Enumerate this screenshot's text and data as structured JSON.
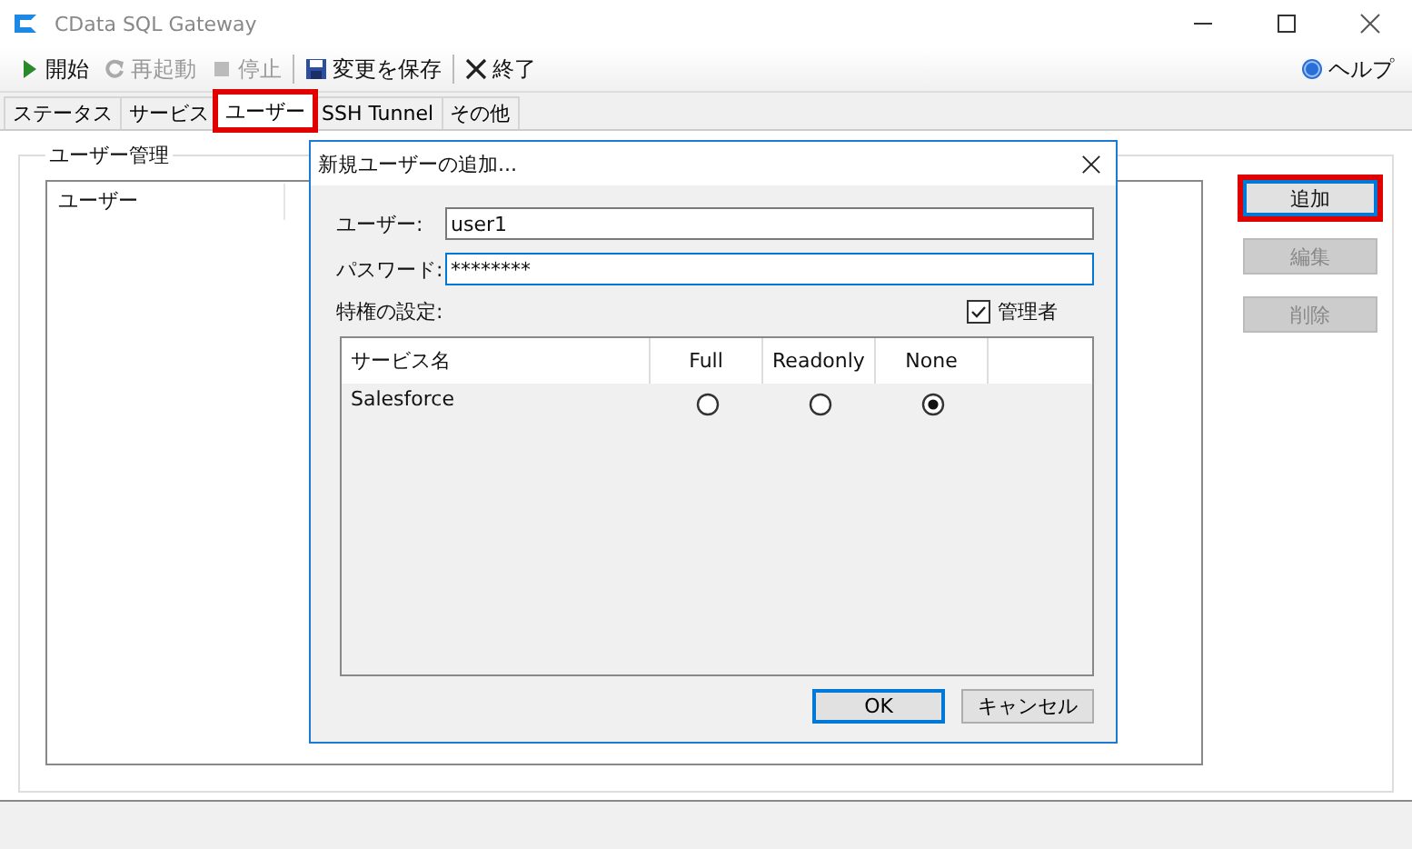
{
  "window": {
    "title": "CData SQL Gateway"
  },
  "toolbar": [
    {
      "label": "開始",
      "kind": "play",
      "disabled": false
    },
    {
      "label": "再起動",
      "kind": "restart",
      "disabled": true
    },
    {
      "label": "停止",
      "kind": "stop",
      "disabled": true
    },
    {
      "label": "変更を保存",
      "kind": "save",
      "disabled": false
    },
    {
      "label": "終了",
      "kind": "exit",
      "disabled": false
    }
  ],
  "help": {
    "label": "ヘルプ"
  },
  "tabs": [
    {
      "label": "ステータス",
      "selected": false,
      "highlighted": false
    },
    {
      "label": "サービス",
      "selected": false,
      "highlighted": false
    },
    {
      "label": "ユーザー",
      "selected": true,
      "highlighted": true
    },
    {
      "label": "SSH Tunnel",
      "selected": false,
      "highlighted": false
    },
    {
      "label": "その他",
      "selected": false,
      "highlighted": false
    }
  ],
  "group": {
    "title": "ユーザー管理",
    "columns": [
      "ユーザー"
    ]
  },
  "side_buttons": [
    {
      "label": "追加",
      "disabled": false,
      "highlighted": true
    },
    {
      "label": "編集",
      "disabled": true,
      "highlighted": false
    },
    {
      "label": "削除",
      "disabled": true,
      "highlighted": false
    }
  ],
  "dialog": {
    "title": "新規ユーザーの追加...",
    "user_label": "ユーザー:",
    "user_value": "user1",
    "password_label": "パスワード:",
    "password_value": "********",
    "privileges_label": "特権の設定:",
    "admin": {
      "label": "管理者",
      "checked": true
    },
    "grid": {
      "columns": [
        "サービス名",
        "Full",
        "Readonly",
        "None"
      ],
      "rows": [
        {
          "service": "Salesforce",
          "selected": [
            false,
            false,
            true
          ]
        }
      ]
    },
    "ok": "OK",
    "cancel": "キャンセル"
  }
}
